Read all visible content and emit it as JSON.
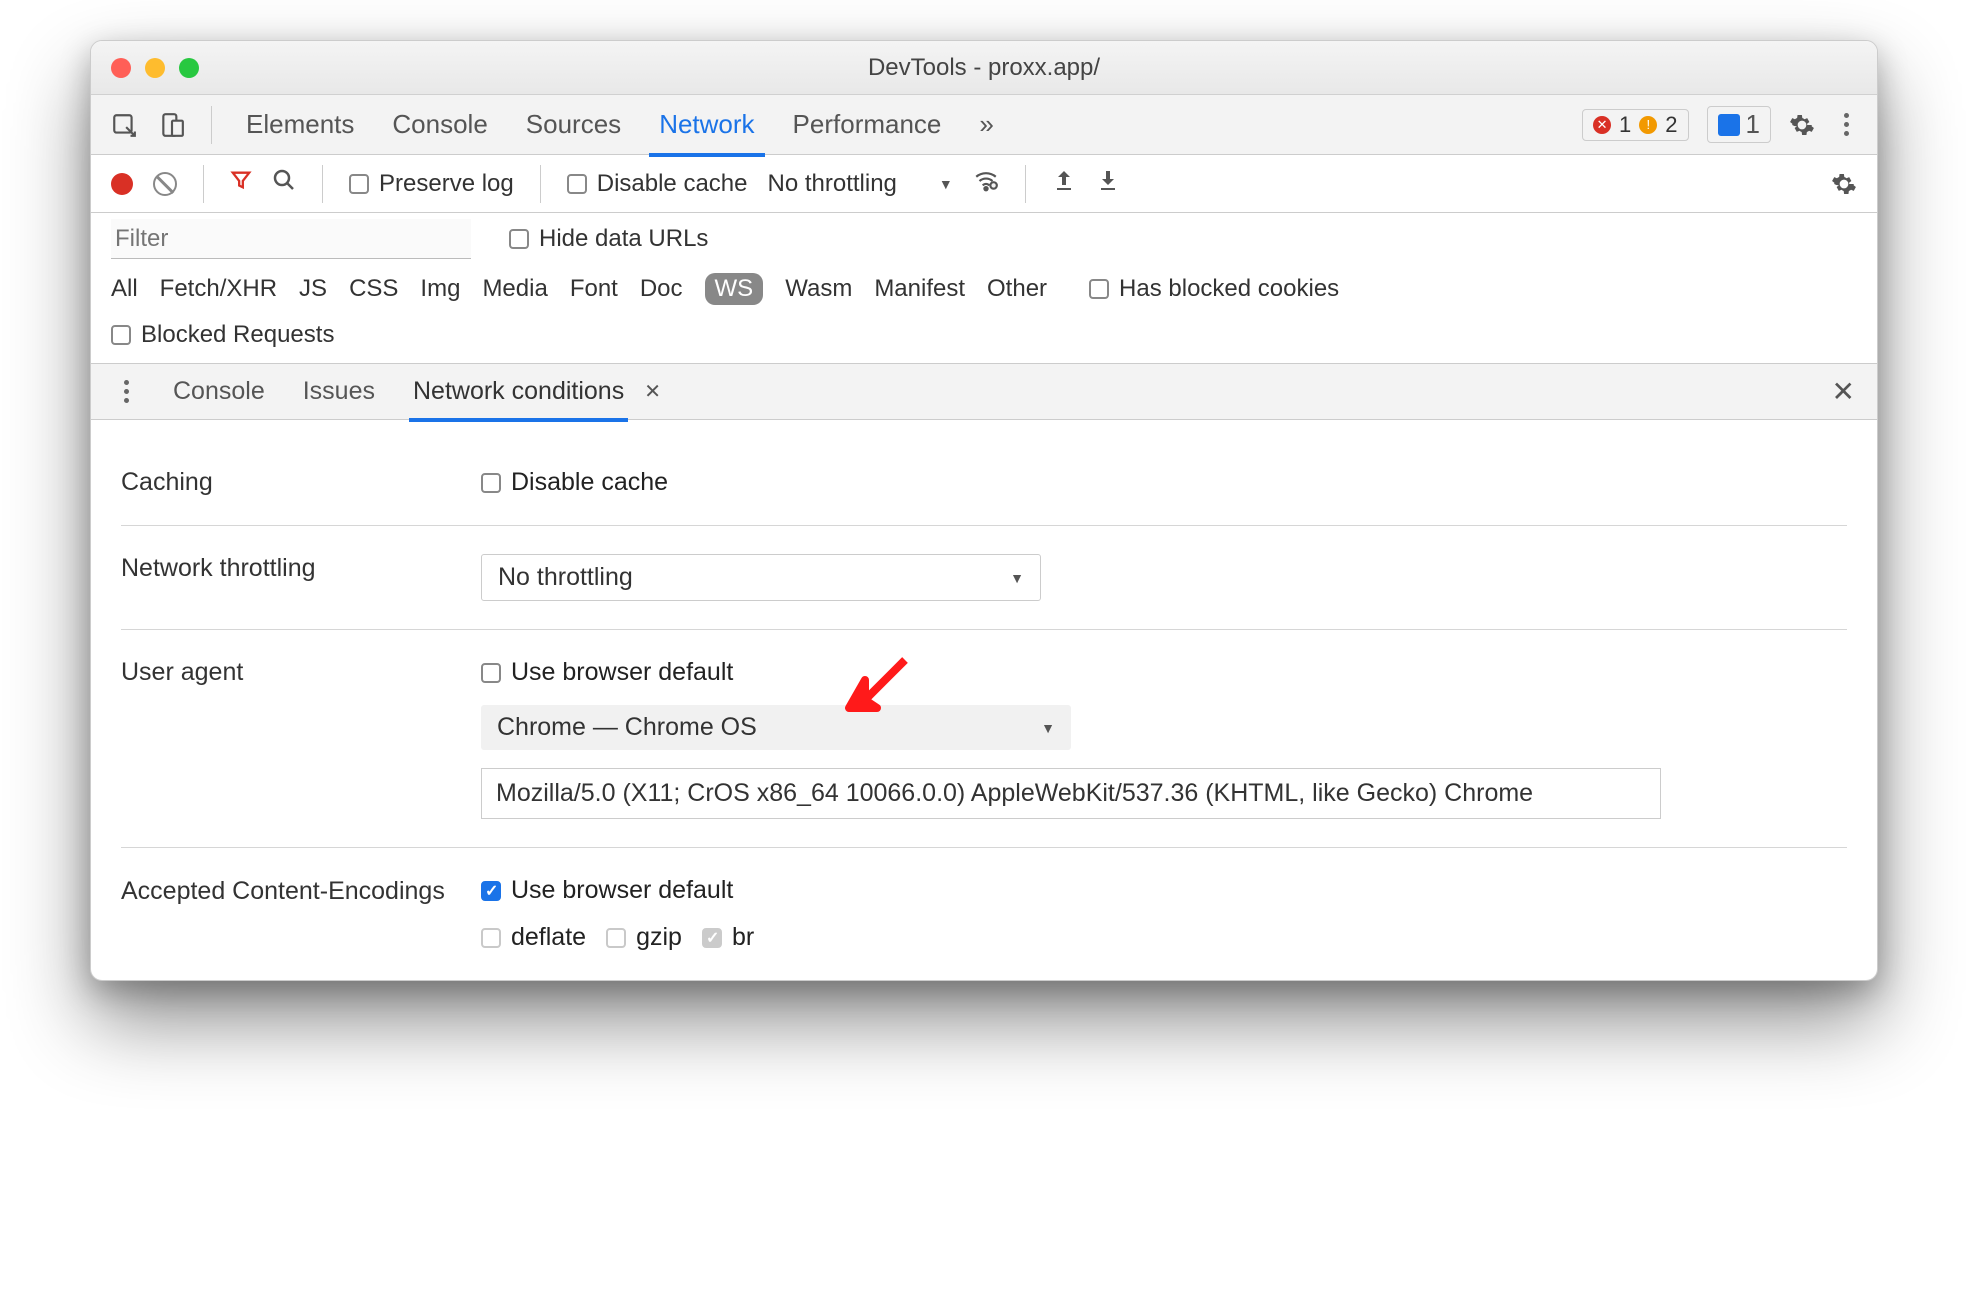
{
  "window": {
    "title": "DevTools - proxx.app/"
  },
  "main_tabs": {
    "items": [
      "Elements",
      "Console",
      "Sources",
      "Network",
      "Performance"
    ],
    "active": "Network",
    "more_icon": "»",
    "error_count": "1",
    "warning_count": "2",
    "issues_count": "1"
  },
  "net_toolbar": {
    "preserve_log": "Preserve log",
    "disable_cache": "Disable cache",
    "throttling": "No throttling"
  },
  "filter": {
    "placeholder": "Filter",
    "hide_data_urls": "Hide data URLs",
    "tags": [
      "All",
      "Fetch/XHR",
      "JS",
      "CSS",
      "Img",
      "Media",
      "Font",
      "Doc",
      "WS",
      "Wasm",
      "Manifest",
      "Other"
    ],
    "has_blocked": "Has blocked cookies",
    "blocked_requests": "Blocked Requests"
  },
  "drawer": {
    "tabs": [
      "Console",
      "Issues",
      "Network conditions"
    ],
    "active": "Network conditions"
  },
  "settings": {
    "caching": {
      "label": "Caching",
      "disable_cache": "Disable cache"
    },
    "throttling": {
      "label": "Network throttling",
      "value": "No throttling"
    },
    "user_agent": {
      "label": "User agent",
      "use_default": "Use browser default",
      "select_value": "Chrome — Chrome OS",
      "ua_string": "Mozilla/5.0 (X11; CrOS x86_64 10066.0.0) AppleWebKit/537.36 (KHTML, like Gecko) Chrome"
    },
    "encodings": {
      "label": "Accepted Content-Encodings",
      "use_default": "Use browser default",
      "opts": {
        "deflate": "deflate",
        "gzip": "gzip",
        "br": "br"
      }
    }
  }
}
